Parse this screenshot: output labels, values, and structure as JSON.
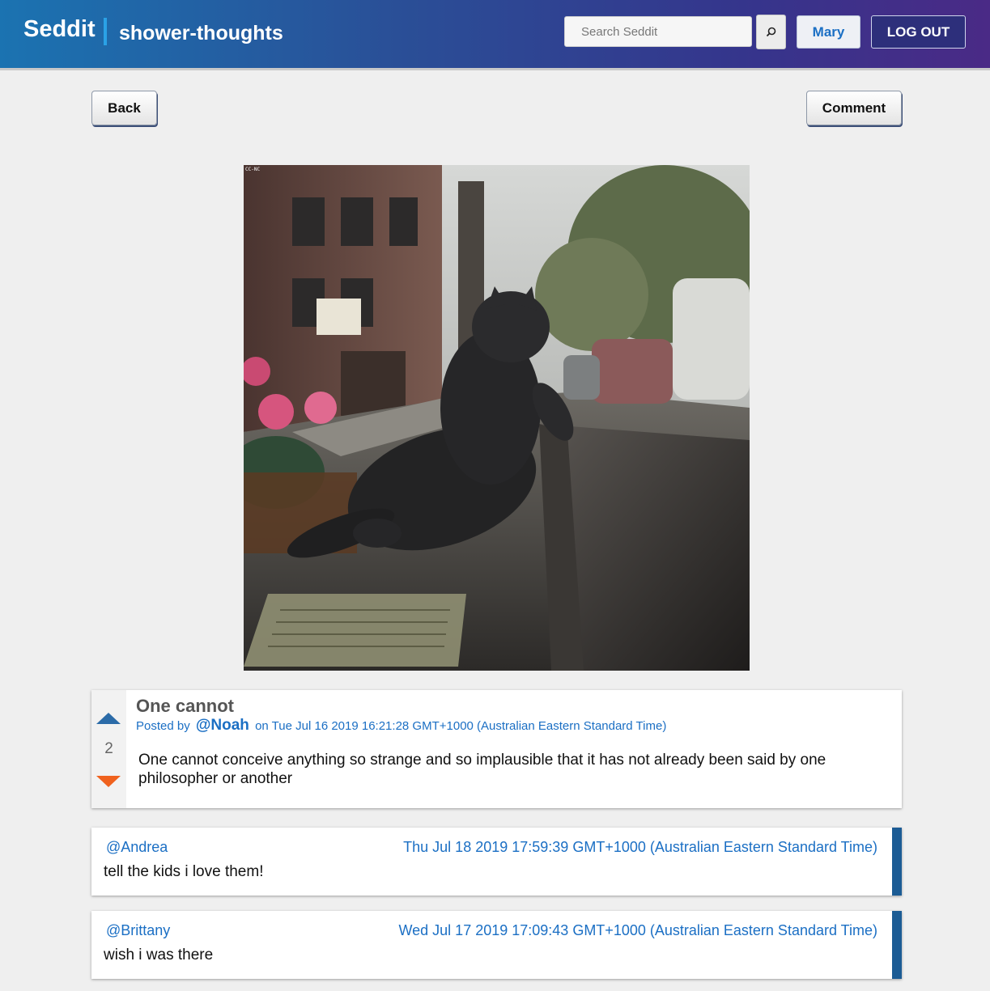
{
  "header": {
    "brand": "Seddit",
    "subreddit": "shower-thoughts",
    "search_placeholder": "Search Seddit",
    "search_icon": "search-icon",
    "user_label": "Mary",
    "logout_label": "LOG OUT"
  },
  "actions": {
    "back_label": "Back",
    "comment_label": "Comment"
  },
  "post": {
    "image_alt": "CC-NC",
    "title": "One cannot",
    "posted_by_prefix": "Posted by",
    "author": "@Noah",
    "date": "on Tue Jul 16 2019 16:21:28 GMT+1000 (Australian Eastern Standard Time)",
    "score": "2",
    "body": "One cannot conceive anything so strange and so implausible that it has not already been said by one philosopher or another"
  },
  "comments": [
    {
      "author": "@Andrea",
      "time": "Thu Jul 18 2019 17:59:39 GMT+1000 (Australian Eastern Standard Time)",
      "text": "tell the kids i love them!"
    },
    {
      "author": "@Brittany",
      "time": "Wed Jul 17 2019 17:09:43 GMT+1000 (Australian Eastern Standard Time)",
      "text": "wish i was there"
    }
  ],
  "colors": {
    "accent": "#1b6fc4",
    "upvote": "#2b6ba8",
    "downvote": "#f0621e",
    "comment_bar": "#1c5c95"
  }
}
